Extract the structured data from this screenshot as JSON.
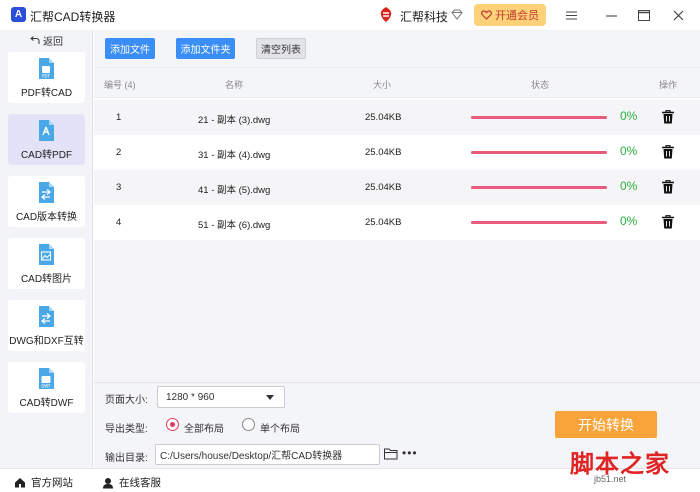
{
  "titlebar": {
    "app_logo_letter": "A",
    "title": "汇帮CAD转换器",
    "brand_name": "汇帮科技",
    "vip_label": "开通会员",
    "icons": [
      "brand-logo-icon",
      "diamond-icon",
      "vip-heart-icon",
      "menu-icon",
      "minimize-icon",
      "maximize-icon",
      "close-icon"
    ]
  },
  "sidebar": {
    "back_label": "返回",
    "items": [
      {
        "label": "PDF转CAD",
        "active": false
      },
      {
        "label": "CAD转PDF",
        "active": true
      },
      {
        "label": "CAD版本转换",
        "active": false
      },
      {
        "label": "CAD转图片",
        "active": false
      },
      {
        "label": "DWG和DXF互转",
        "active": false
      },
      {
        "label": "CAD转DWF",
        "active": false
      }
    ]
  },
  "toolbar": {
    "add_file": "添加文件",
    "add_folder": "添加文件夹",
    "clear_list": "清空列表"
  },
  "table": {
    "headers": {
      "index": "编号 (4)",
      "name": "名称",
      "size": "大小",
      "status": "状态",
      "action": "操作"
    },
    "rows": [
      {
        "index": "1",
        "name": "21 - 副本 (3).dwg",
        "size": "25.04KB",
        "percent": "0%",
        "progress": 1.0
      },
      {
        "index": "2",
        "name": "31 - 副本 (4).dwg",
        "size": "25.04KB",
        "percent": "0%",
        "progress": 1.0
      },
      {
        "index": "3",
        "name": "41 - 副本 (5).dwg",
        "size": "25.04KB",
        "percent": "0%",
        "progress": 1.0
      },
      {
        "index": "4",
        "name": "51 - 副本 (6).dwg",
        "size": "25.04KB",
        "percent": "0%",
        "progress": 1.0
      }
    ]
  },
  "settings": {
    "page_size_label": "页面大小:",
    "page_size_value": "1280 * 960",
    "export_type_label": "导出类型:",
    "export_options": [
      {
        "label": "全部布局",
        "checked": true
      },
      {
        "label": "单个布局",
        "checked": false
      }
    ],
    "output_dir_label": "输出目录:",
    "output_dir_value": "C:/Users/house/Desktop/汇帮CAD转换器",
    "more_label": "•••",
    "start_label": "开始转换"
  },
  "footer": {
    "website": "官方网站",
    "support": "在线客服"
  },
  "watermark": {
    "text": "脚本之家",
    "sub": "jb51.net"
  },
  "colors": {
    "accent_blue": "#3a8ef6",
    "start_orange": "#f8a43a",
    "vip_yellow": "#ffd27a",
    "progress_pink": "#e85b7d",
    "percent_green": "#27b03c",
    "radio_red": "#e8375c"
  }
}
